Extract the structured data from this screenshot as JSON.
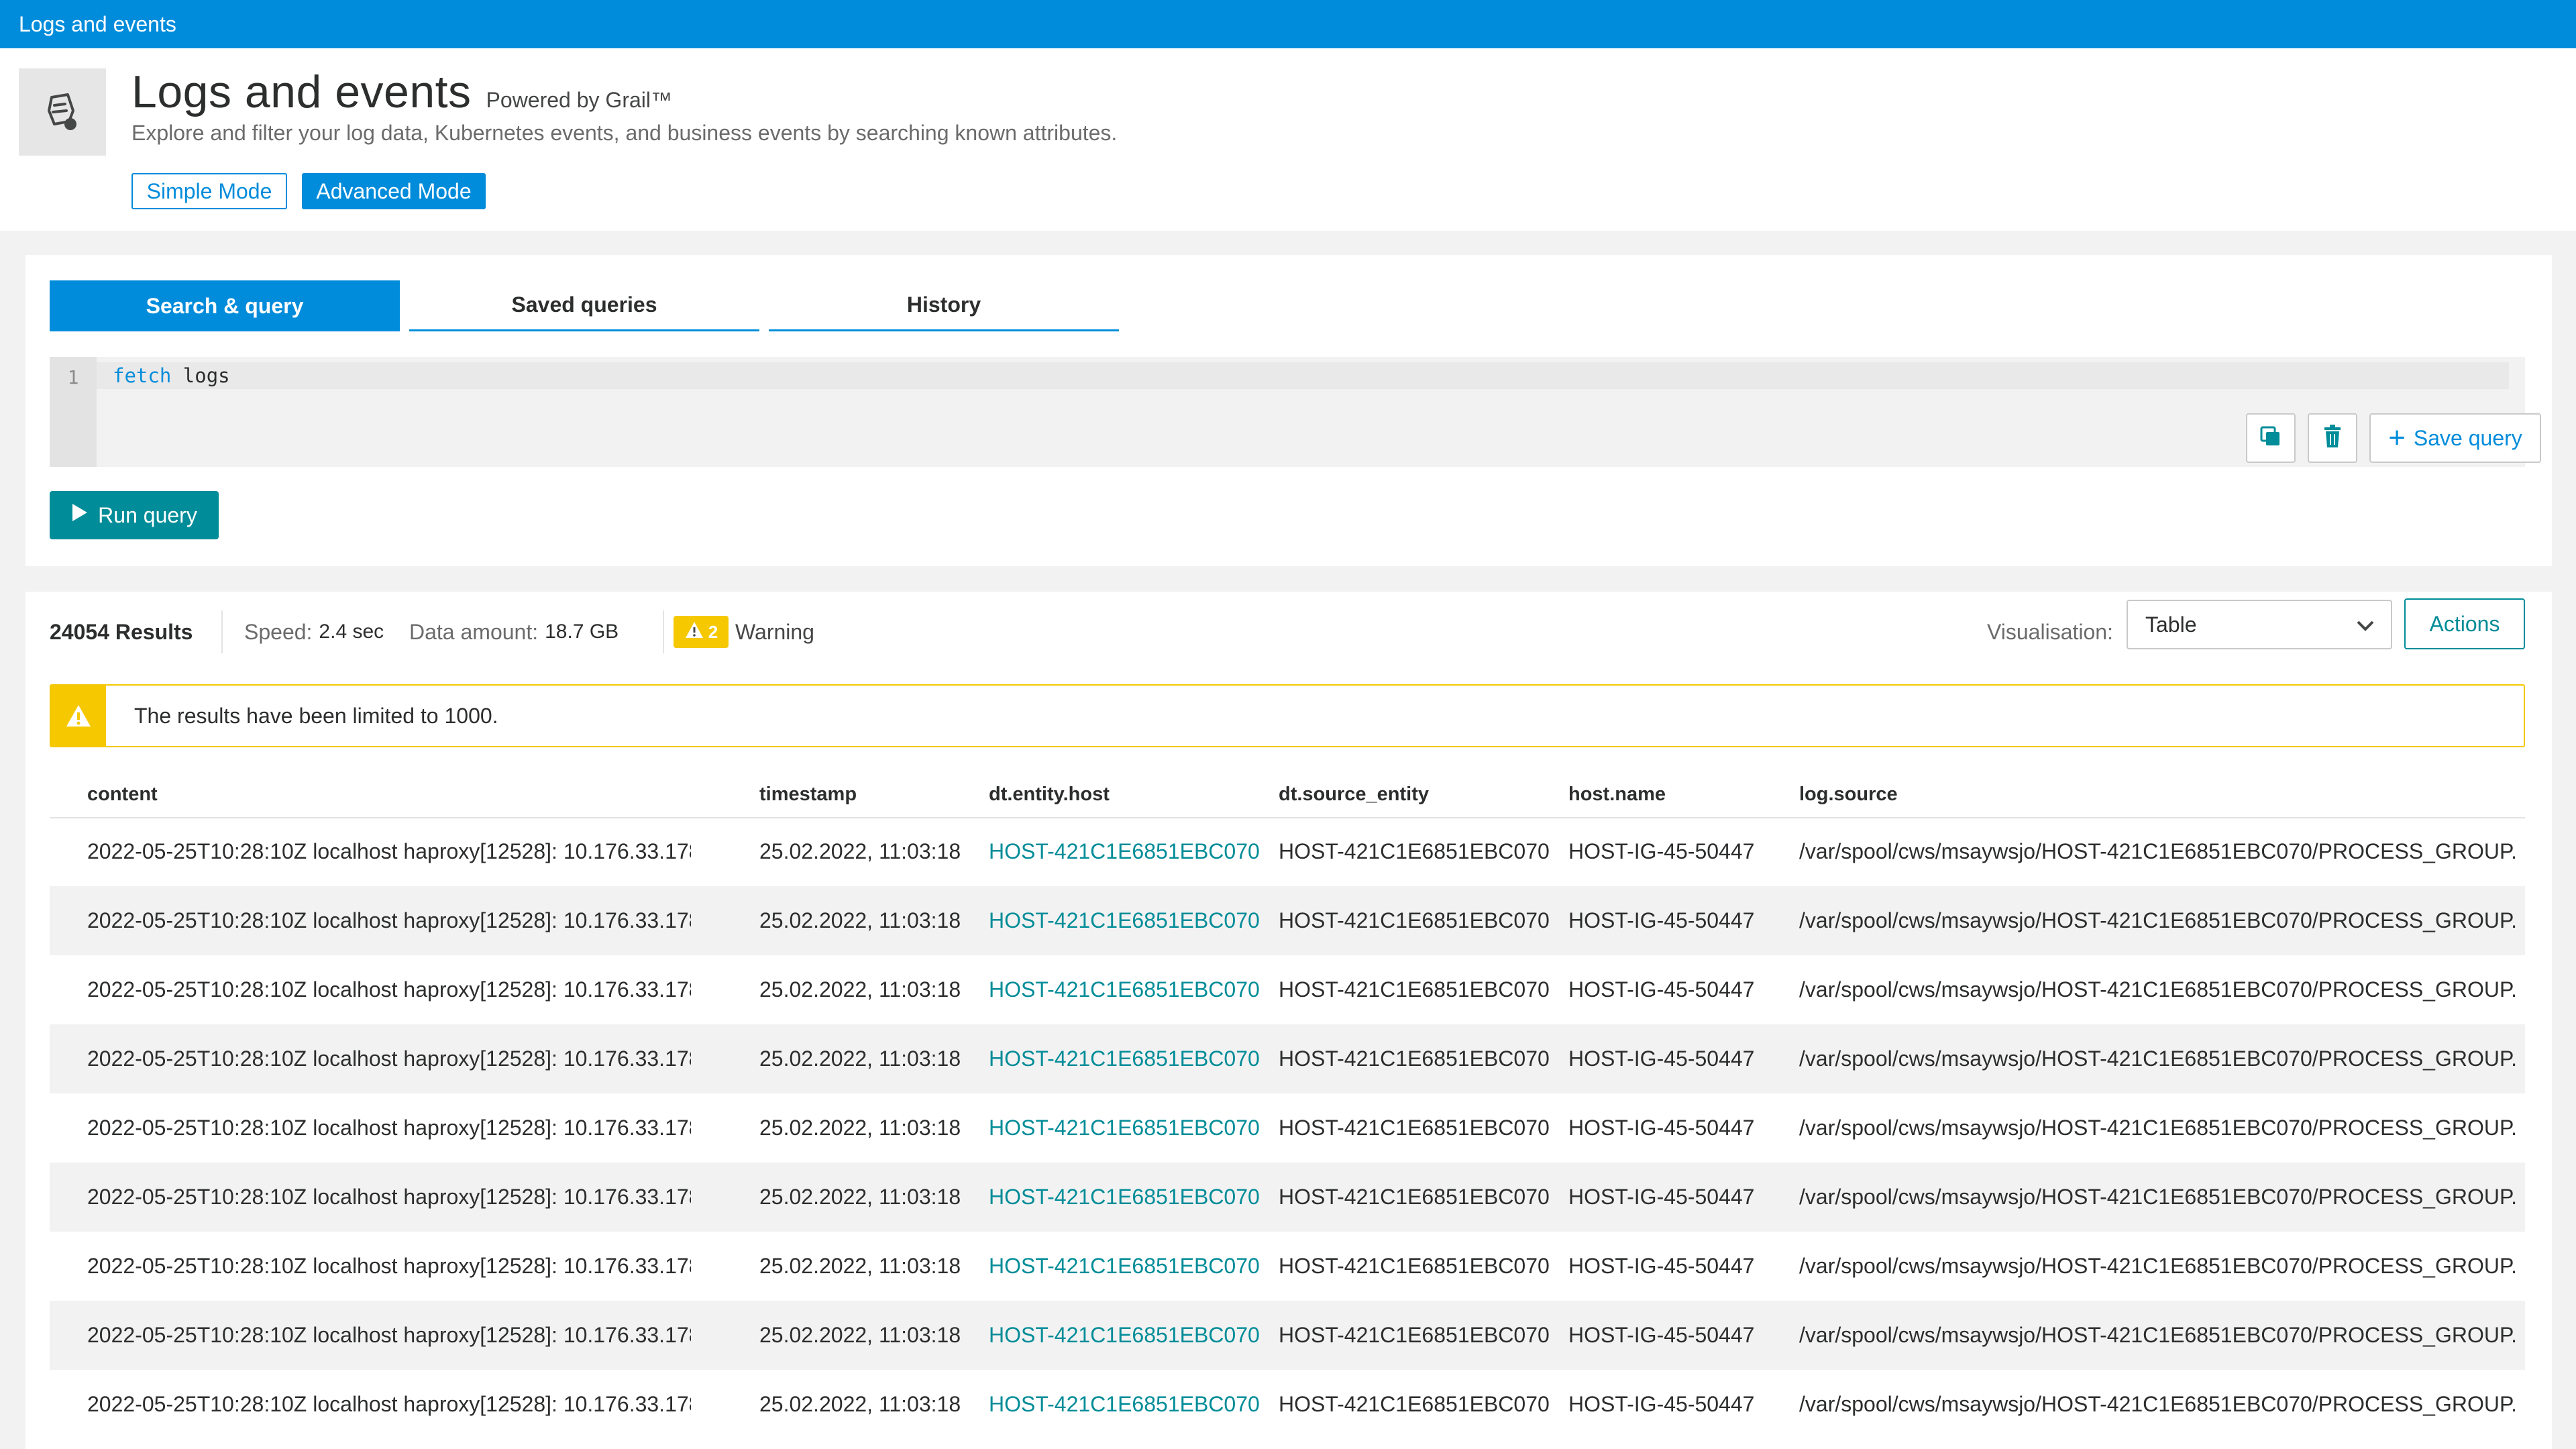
{
  "topbar": {
    "title": "Logs and events"
  },
  "header": {
    "title": "Logs and events",
    "powered": "Powered by Grail™",
    "subtitle": "Explore and filter your log data, Kubernetes events, and business events by searching known attributes.",
    "modes": {
      "simple": "Simple Mode",
      "advanced": "Advanced Mode"
    }
  },
  "query": {
    "tabs": {
      "search": "Search & query",
      "saved": "Saved queries",
      "history": "History"
    },
    "editor": {
      "line_number": "1",
      "keyword": "fetch",
      "text": "logs"
    },
    "save_label": "Save query",
    "run_label": "Run query"
  },
  "results": {
    "count": "24054 Results",
    "speed_label": "Speed:",
    "speed_value": "2.4 sec",
    "data_label": "Data amount:",
    "data_value": "18.7 GB",
    "warning_count": "2",
    "warning_label": "Warning",
    "visualisation_label": "Visualisation:",
    "visualisation_value": "Table",
    "actions_label": "Actions",
    "banner": "The results have been limited to 1000.",
    "columns": [
      "content",
      "timestamp",
      "dt.entity.host",
      "dt.source_entity",
      "host.name",
      "log.source"
    ],
    "rows": [
      [
        "2022-05-25T10:28:10Z localhost haproxy[12528]: 10.176.33.178...",
        "25.02.2022, 11:03:18",
        "HOST-421C1E6851EBC070",
        "HOST-421C1E6851EBC070",
        "HOST-IG-45-50447",
        "/var/spool/cws/msaywsjo/HOST-421C1E6851EBC070/PROCESS_GROUP..."
      ],
      [
        "2022-05-25T10:28:10Z localhost haproxy[12528]: 10.176.33.178...",
        "25.02.2022, 11:03:18",
        "HOST-421C1E6851EBC070",
        "HOST-421C1E6851EBC070",
        "HOST-IG-45-50447",
        "/var/spool/cws/msaywsjo/HOST-421C1E6851EBC070/PROCESS_GROUP..."
      ],
      [
        "2022-05-25T10:28:10Z localhost haproxy[12528]: 10.176.33.178...",
        "25.02.2022, 11:03:18",
        "HOST-421C1E6851EBC070",
        "HOST-421C1E6851EBC070",
        "HOST-IG-45-50447",
        "/var/spool/cws/msaywsjo/HOST-421C1E6851EBC070/PROCESS_GROUP..."
      ],
      [
        "2022-05-25T10:28:10Z localhost haproxy[12528]: 10.176.33.178...",
        "25.02.2022, 11:03:18",
        "HOST-421C1E6851EBC070",
        "HOST-421C1E6851EBC070",
        "HOST-IG-45-50447",
        "/var/spool/cws/msaywsjo/HOST-421C1E6851EBC070/PROCESS_GROUP..."
      ],
      [
        "2022-05-25T10:28:10Z localhost haproxy[12528]: 10.176.33.178...",
        "25.02.2022, 11:03:18",
        "HOST-421C1E6851EBC070",
        "HOST-421C1E6851EBC070",
        "HOST-IG-45-50447",
        "/var/spool/cws/msaywsjo/HOST-421C1E6851EBC070/PROCESS_GROUP..."
      ],
      [
        "2022-05-25T10:28:10Z localhost haproxy[12528]: 10.176.33.178...",
        "25.02.2022, 11:03:18",
        "HOST-421C1E6851EBC070",
        "HOST-421C1E6851EBC070",
        "HOST-IG-45-50447",
        "/var/spool/cws/msaywsjo/HOST-421C1E6851EBC070/PROCESS_GROUP..."
      ],
      [
        "2022-05-25T10:28:10Z localhost haproxy[12528]: 10.176.33.178...",
        "25.02.2022, 11:03:18",
        "HOST-421C1E6851EBC070",
        "HOST-421C1E6851EBC070",
        "HOST-IG-45-50447",
        "/var/spool/cws/msaywsjo/HOST-421C1E6851EBC070/PROCESS_GROUP..."
      ],
      [
        "2022-05-25T10:28:10Z localhost haproxy[12528]: 10.176.33.178...",
        "25.02.2022, 11:03:18",
        "HOST-421C1E6851EBC070",
        "HOST-421C1E6851EBC070",
        "HOST-IG-45-50447",
        "/var/spool/cws/msaywsjo/HOST-421C1E6851EBC070/PROCESS_GROUP..."
      ],
      [
        "2022-05-25T10:28:10Z localhost haproxy[12528]: 10.176.33.178...",
        "25.02.2022, 11:03:18",
        "HOST-421C1E6851EBC070",
        "HOST-421C1E6851EBC070",
        "HOST-IG-45-50447",
        "/var/spool/cws/msaywsjo/HOST-421C1E6851EBC070/PROCESS_GROUP..."
      ]
    ]
  },
  "colors": {
    "brand_blue": "#008cdb",
    "teal": "#008c98",
    "warning_yellow": "#f5c800"
  },
  "icons": [
    "logs-app-icon",
    "copy-icon",
    "trash-icon",
    "plus-icon",
    "play-icon",
    "warning-icon",
    "chevron-down-icon"
  ]
}
